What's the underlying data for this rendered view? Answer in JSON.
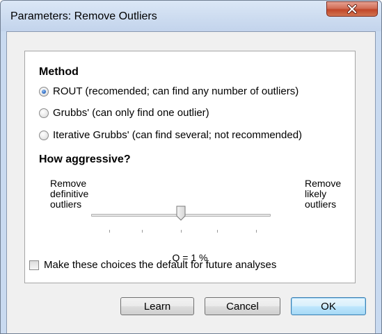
{
  "window": {
    "title": "Parameters: Remove Outliers",
    "close_icon": "close-icon",
    "colors": {
      "title_bar": "#cddcf0",
      "close_button": "#c14729",
      "default_button_border": "#3c7fb1"
    }
  },
  "method": {
    "heading": "Method",
    "options": [
      {
        "label": "ROUT (recomended; can find any number of outliers)",
        "selected": true
      },
      {
        "label": "Grubbs' (can only find one outlier)",
        "selected": false
      },
      {
        "label": "Iterative Grubbs' (can find several; not recommended)",
        "selected": false
      }
    ]
  },
  "aggressive": {
    "heading": "How aggressive?",
    "left_label": [
      "Remove",
      "definitive",
      "outliers"
    ],
    "right_label": [
      "Remove",
      "likely",
      "outliers"
    ],
    "slider_level": 0.5,
    "q_text": "Q = 1 %"
  },
  "default_checkbox": {
    "label": "Make these choices the default for future analyses",
    "checked": false
  },
  "buttons": {
    "learn": "Learn",
    "cancel": "Cancel",
    "ok": "OK"
  }
}
